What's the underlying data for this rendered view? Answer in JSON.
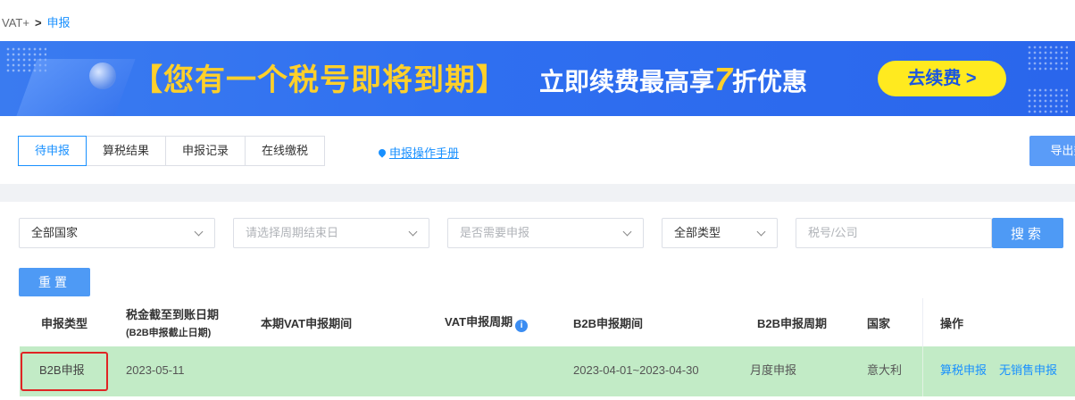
{
  "breadcrumb": {
    "root": "VAT+",
    "separator": ">",
    "current": "申报"
  },
  "banner": {
    "title": "【您有一个税号即将到期】",
    "offer_prefix": "立即续费最高享",
    "offer_number": "7",
    "offer_suffix": "折优惠",
    "renew_label": "去续费 >"
  },
  "tabs": [
    {
      "label": "待申报",
      "active": true
    },
    {
      "label": "算税结果",
      "active": false
    },
    {
      "label": "申报记录",
      "active": false
    },
    {
      "label": "在线缴税",
      "active": false
    }
  ],
  "manual_link": "申报操作手册",
  "export_label": "导出数",
  "filters": {
    "country": "全部国家",
    "period_end_placeholder": "请选择周期结束日",
    "need_declare_placeholder": "是否需要申报",
    "type": "全部类型",
    "search_placeholder": "税号/公司",
    "search_label": "搜索",
    "reset_label": "重置"
  },
  "table": {
    "headers": {
      "type": "申报类型",
      "deadline": "税金截至到账日期",
      "deadline_sub": "(B2B申报截止日期)",
      "vat_period": "本期VAT申报期间",
      "vat_cycle": "VAT申报周期",
      "vat_cycle_icon": "info-icon",
      "b2b_period": "B2B申报期间",
      "b2b_cycle": "B2B申报周期",
      "country": "国家",
      "actions": "操作"
    },
    "rows": [
      {
        "type": "B2B申报",
        "deadline": "2023-05-11",
        "vat_period": "",
        "vat_cycle": "",
        "b2b_period": "2023-04-01~2023-04-30",
        "b2b_cycle": "月度申报",
        "country": "意大利",
        "action_calc": "算税申报",
        "action_nosale": "无销售申报"
      }
    ]
  },
  "colors": {
    "accent": "#1890ff",
    "row_highlight": "#c2ebc6",
    "banner_title": "#ffd02a",
    "annotation": "#e02424"
  }
}
